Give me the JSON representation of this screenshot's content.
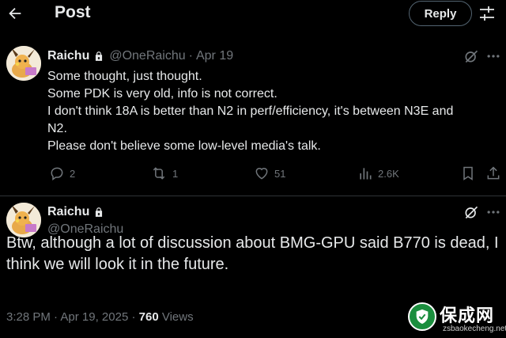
{
  "header": {
    "title": "Post",
    "reply_label": "Reply"
  },
  "tweet1": {
    "name": "Raichu",
    "handle": "@OneRaichu",
    "date": "Apr 19",
    "lines": [
      "Some thought, just thought.",
      "Some PDK is very old, info is not correct.",
      "I don't think 18A is better than N2 in perf/efficiency, it's between N3E and",
      "N2.",
      "Please don't believe some low-level media's talk."
    ],
    "replies": "2",
    "reposts": "1",
    "likes": "51",
    "views": "2.6K"
  },
  "tweet2": {
    "name": "Raichu",
    "handle": "@OneRaichu",
    "text": "Btw, although a lot of discussion about BMG-GPU said B770 is dead, I think we will look it in the future.",
    "time": "3:28 PM",
    "date": "Apr 19, 2025",
    "views_count": "760",
    "views_label": "Views"
  },
  "watermark": {
    "title": "保成网",
    "url": "zsbaokecheng.net"
  },
  "colors": {
    "background": "#000000",
    "text": "#e7e9ea",
    "muted": "#71767b",
    "divider": "#2f3336"
  },
  "icons": [
    "back-arrow-icon",
    "filter-icon",
    "lock-icon",
    "grok-icon",
    "more-icon",
    "reply-icon",
    "repost-icon",
    "like-icon",
    "views-icon",
    "bookmark-icon",
    "share-icon"
  ]
}
